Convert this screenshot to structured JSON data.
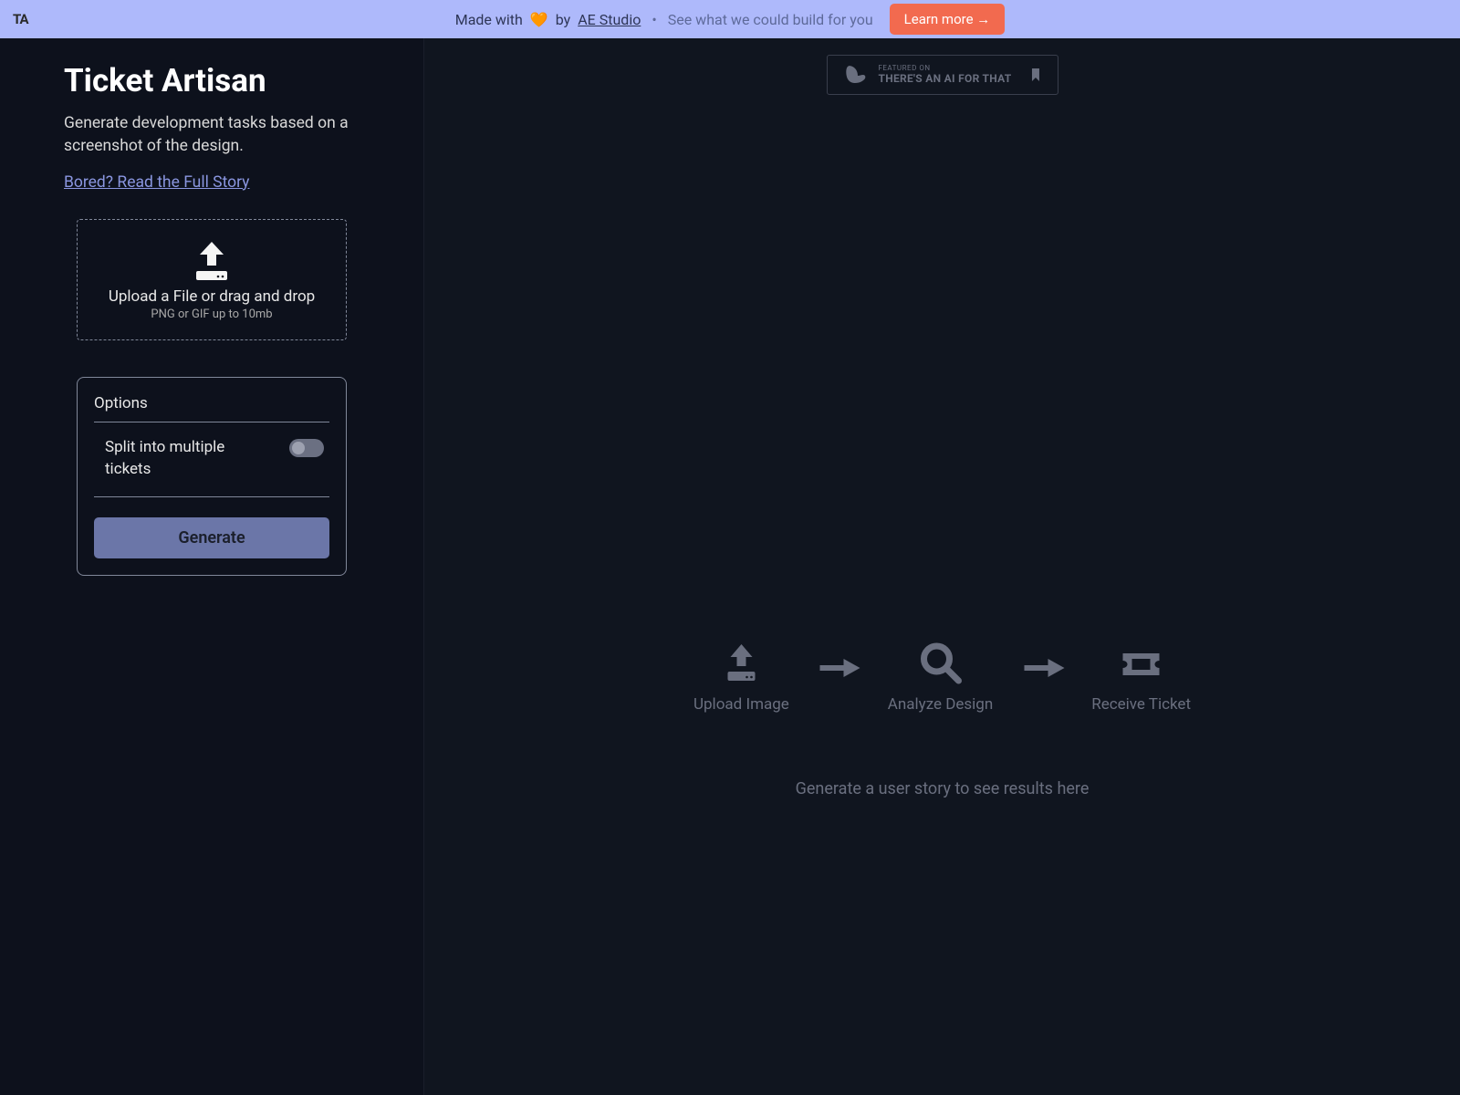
{
  "banner": {
    "made_with": "Made with ",
    "by": "by ",
    "studio": "AE Studio",
    "see_what": "See what we could build for you",
    "learn_more": "Learn more →",
    "logo": "TA"
  },
  "sidebar": {
    "title": "Ticket Artisan",
    "description": "Generate development tasks based on a screenshot of the design.",
    "full_story": "Bored? Read the Full Story",
    "upload_main": "Upload a File or drag and drop",
    "upload_sub": "PNG or GIF up to 10mb",
    "options_title": "Options",
    "split_label": "Split into multiple tickets",
    "generate": "Generate"
  },
  "featured": {
    "small": "FEATURED ON",
    "big": "THERE'S AN AI FOR THAT"
  },
  "steps": {
    "upload": "Upload Image",
    "analyze": "Analyze Design",
    "receive": "Receive Ticket"
  },
  "placeholder": "Generate a user story to see results here"
}
